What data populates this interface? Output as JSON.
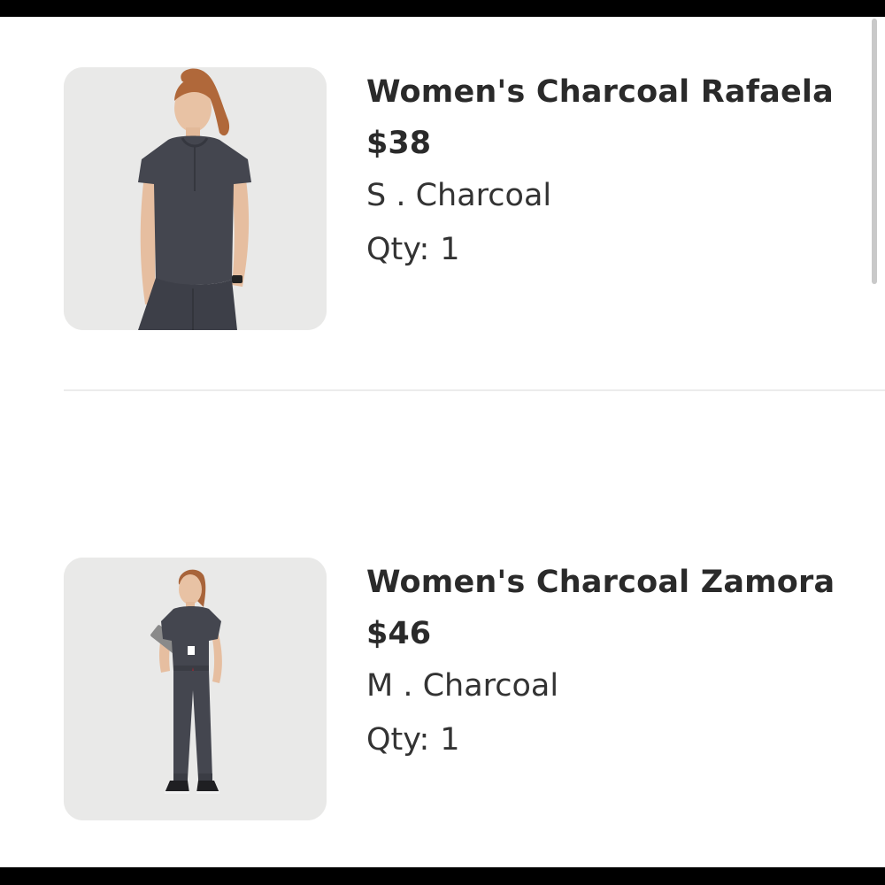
{
  "cart_items": [
    {
      "name": "Women's Charcoal Rafaela",
      "price": "$38",
      "variant": "S . Charcoal",
      "qty_label": "Qty:",
      "qty_value": "1",
      "image_alt": "product-photo-top"
    },
    {
      "name": "Women's Charcoal Zamora",
      "price": "$46",
      "variant": "M . Charcoal",
      "qty_label": "Qty:",
      "qty_value": "1",
      "image_alt": "product-photo-jumpsuit"
    }
  ],
  "colors": {
    "text": "#2a2a2a",
    "garment": "#44464f",
    "image_background": "#e9e9e8",
    "divider": "#ececec"
  }
}
